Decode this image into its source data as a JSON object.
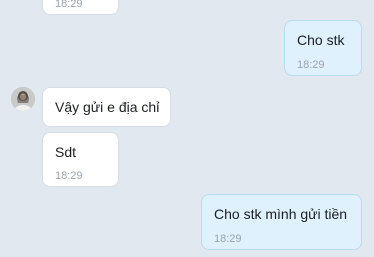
{
  "conversation": {
    "messages": [
      {
        "id": "m0",
        "direction": "incoming",
        "text": "",
        "time": "18:29"
      },
      {
        "id": "m1",
        "direction": "outgoing",
        "text": "Cho stk",
        "time": "18:29"
      },
      {
        "id": "m2",
        "direction": "incoming",
        "text": "Vậy gửi e địa chỉ",
        "time": ""
      },
      {
        "id": "m3",
        "direction": "incoming",
        "text": "Sdt",
        "time": "18:29"
      },
      {
        "id": "m4",
        "direction": "outgoing",
        "text": "Cho stk mình gửi tiền",
        "time": "18:29"
      }
    ]
  },
  "sender": {
    "avatar_icon": "user-avatar-photo"
  },
  "colors": {
    "background": "#e2e8f0",
    "incoming_bubble": "#ffffff",
    "outgoing_bubble": "#dff1fd",
    "timestamp": "#9aa4ad"
  }
}
